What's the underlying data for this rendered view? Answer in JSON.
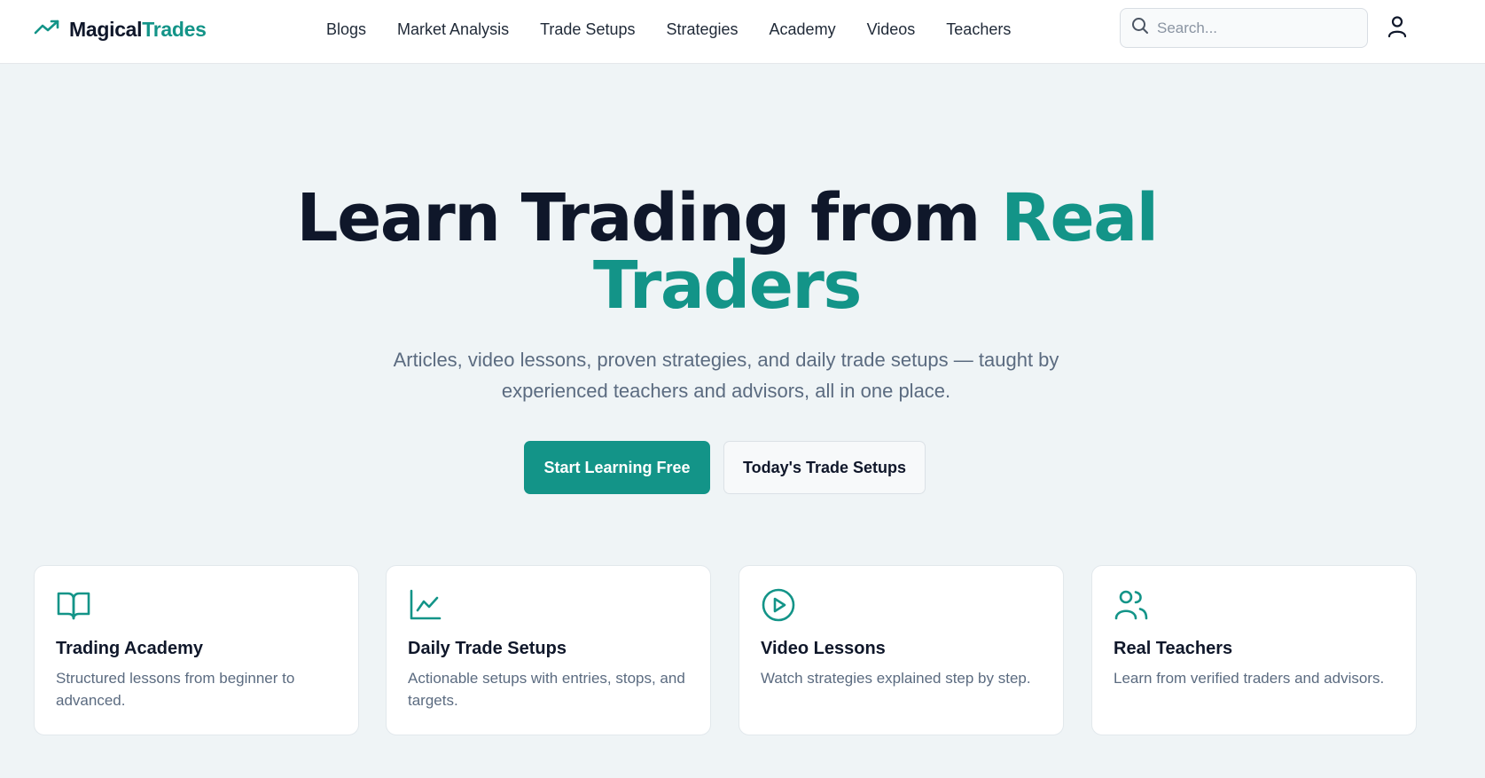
{
  "brand": {
    "name_part1": "Magical",
    "name_part2": "Trades",
    "accent": "#139488",
    "icon": "trending-up-icon"
  },
  "nav": {
    "items": [
      {
        "label": "Blogs"
      },
      {
        "label": "Market Analysis"
      },
      {
        "label": "Trade Setups"
      },
      {
        "label": "Strategies"
      },
      {
        "label": "Academy"
      },
      {
        "label": "Videos"
      },
      {
        "label": "Teachers"
      }
    ]
  },
  "search": {
    "placeholder": "Search...",
    "icon": "search-icon"
  },
  "user": {
    "icon": "user-icon"
  },
  "hero": {
    "title_dark": "Learn Trading from ",
    "title_teal_1": "Real",
    "title_teal_2": "Traders",
    "subtitle": "Articles, video lessons, proven strategies, and daily trade setups — taught by experienced teachers and advisors, all in one place.",
    "primary_cta": "Start Learning Free",
    "secondary_cta": "Today's Trade Setups"
  },
  "features": [
    {
      "icon": "book-open-icon",
      "title": "Trading Academy",
      "desc": "Structured lessons from beginner to advanced."
    },
    {
      "icon": "line-chart-icon",
      "title": "Daily Trade Setups",
      "desc": "Actionable setups with entries, stops, and targets."
    },
    {
      "icon": "play-circle-icon",
      "title": "Video Lessons",
      "desc": "Watch strategies explained step by step."
    },
    {
      "icon": "users-icon",
      "title": "Real Teachers",
      "desc": "Learn from verified traders and advisors."
    }
  ]
}
